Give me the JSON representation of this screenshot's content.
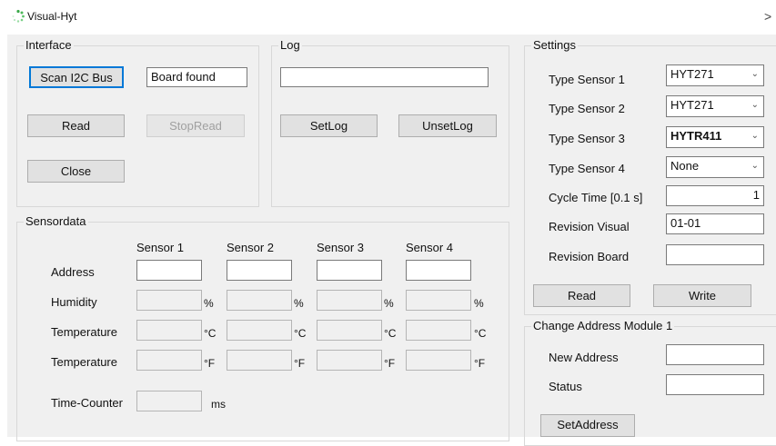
{
  "window": {
    "title": "Visual-Hyt",
    "close_glyph": ">"
  },
  "interface": {
    "title": "Interface",
    "scan_label": "Scan I2C Bus",
    "board_status": "Board found",
    "read_label": "Read",
    "stopread_label": "StopRead",
    "close_label": "Close"
  },
  "log": {
    "title": "Log",
    "log_value": "",
    "setlog_label": "SetLog",
    "unsetlog_label": "UnsetLog"
  },
  "settings": {
    "title": "Settings",
    "sensor1_label": "Type Sensor 1",
    "sensor1_value": "HYT271",
    "sensor2_label": "Type Sensor 2",
    "sensor2_value": "HYT271",
    "sensor3_label": "Type Sensor 3",
    "sensor3_value": "HYTR411",
    "sensor4_label": "Type Sensor 4",
    "sensor4_value": "None",
    "cycle_label": "Cycle Time [0.1 s]",
    "cycle_value": "1",
    "revvisual_label": "Revision Visual",
    "revvisual_value": "01-01",
    "revboard_label": "Revision Board",
    "revboard_value": "",
    "read_label": "Read",
    "write_label": "Write"
  },
  "change_address": {
    "title": "Change Address Module 1",
    "newaddr_label": "New Address",
    "status_label": "Status",
    "button_label": "SetAddress"
  },
  "sensordata": {
    "title": "Sensordata",
    "columns": [
      "Sensor 1",
      "Sensor 2",
      "Sensor 3",
      "Sensor 4"
    ],
    "rows": {
      "address": "Address",
      "humidity": "Humidity",
      "temp_c": "Temperature",
      "temp_f": "Temperature"
    },
    "units": {
      "humidity": "%",
      "temp_c": "°C",
      "temp_f": "°F"
    },
    "timecounter_label": "Time-Counter",
    "timecounter_unit": "ms"
  },
  "icons": {
    "app": "spinner-dots-icon",
    "dropdown": "chevron-down-icon"
  }
}
